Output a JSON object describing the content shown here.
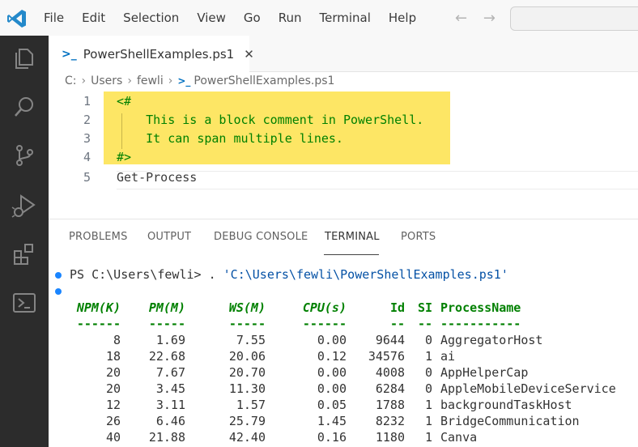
{
  "menu": [
    "File",
    "Edit",
    "Selection",
    "View",
    "Go",
    "Run",
    "Terminal",
    "Help"
  ],
  "nav": {
    "back": "←",
    "forward": "→"
  },
  "tab": {
    "icon": ">_",
    "label": "PowerShellExamples.ps1",
    "close": "✕"
  },
  "breadcrumb": [
    "C:",
    "Users",
    "fewli",
    "PowerShellExamples.ps1"
  ],
  "editor": {
    "lines": [
      {
        "num": "1",
        "text": "<#",
        "kind": "comment"
      },
      {
        "num": "2",
        "text": "    This is a block comment in PowerShell.",
        "kind": "comment"
      },
      {
        "num": "3",
        "text": "    It can span multiple lines.",
        "kind": "comment"
      },
      {
        "num": "4",
        "text": "#>",
        "kind": "comment"
      },
      {
        "num": "5",
        "text": "Get-Process",
        "kind": "plain"
      }
    ],
    "highlight_color": "#fde665"
  },
  "panel": {
    "tabs": [
      "PROBLEMS",
      "OUTPUT",
      "DEBUG CONSOLE",
      "TERMINAL",
      "PORTS"
    ],
    "active": "TERMINAL"
  },
  "terminal": {
    "prompt": "PS C:\\Users\\fewli> . ",
    "command_path": "'C:\\Users\\fewli\\PowerShellExamples.ps1'",
    "columns": [
      "NPM(K)",
      "PM(M)",
      "WS(M)",
      "CPU(s)",
      "Id",
      "SI",
      "ProcessName"
    ],
    "dashes": [
      "------",
      "-----",
      "-----",
      "------",
      "--",
      "--",
      "-----------"
    ],
    "rows": [
      [
        "8",
        "1.69",
        "7.55",
        "0.00",
        "9644",
        "0",
        "AggregatorHost"
      ],
      [
        "18",
        "22.68",
        "20.06",
        "0.12",
        "34576",
        "1",
        "ai"
      ],
      [
        "20",
        "7.67",
        "20.70",
        "0.00",
        "4008",
        "0",
        "AppHelperCap"
      ],
      [
        "20",
        "3.45",
        "11.30",
        "0.00",
        "6284",
        "0",
        "AppleMobileDeviceService"
      ],
      [
        "12",
        "3.11",
        "1.57",
        "0.05",
        "1788",
        "1",
        "backgroundTaskHost"
      ],
      [
        "26",
        "6.46",
        "25.79",
        "1.45",
        "8232",
        "1",
        "BridgeCommunication"
      ],
      [
        "40",
        "21.88",
        "42.40",
        "0.16",
        "1180",
        "1",
        "Canva"
      ]
    ]
  },
  "colors": {
    "accent": "#0070c1",
    "terminal_header": "#008000",
    "activity_bar": "#2c2c2c"
  }
}
